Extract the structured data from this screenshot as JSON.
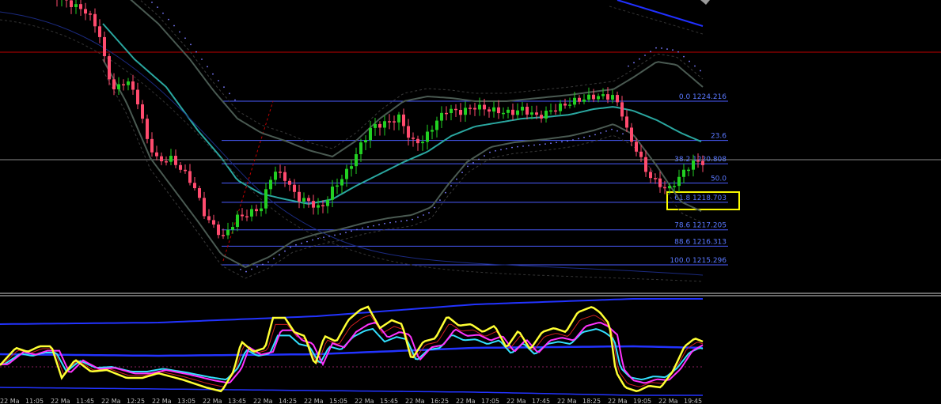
{
  "chart_data": {
    "type": "candlestick",
    "fib_levels": [
      {
        "label": "0.0 1224.216",
        "price": 1224.216
      },
      {
        "label": "23.6",
        "price": 1222.08
      },
      {
        "label": "38.2 1220.808",
        "price": 1220.808
      },
      {
        "label": "50.0",
        "price": 1219.756
      },
      {
        "label": "61.8 1218.703",
        "price": 1218.703
      },
      {
        "label": "78.6 1217.205",
        "price": 1217.205
      },
      {
        "label": "88.6 1216.313",
        "price": 1216.313
      },
      {
        "label": "100.0 1215.296",
        "price": 1215.296
      }
    ],
    "highlighted_level": "61.8 1218.703",
    "x_tick_labels": [
      "22 Ma",
      "11:05",
      "22 Ma",
      "11:45",
      "22 Ma",
      "12:25",
      "22 Ma",
      "13:05",
      "22 Ma",
      "13:45",
      "22 Ma",
      "14:25",
      "22 Ma",
      "15:05",
      "22 Ma",
      "15:45",
      "22 Ma",
      "16:25",
      "22 Ma",
      "17:05",
      "22 Ma",
      "17:45",
      "22 Ma",
      "18:25",
      "22 Ma",
      "19:05",
      "22 Ma",
      "19:45"
    ],
    "colors": {
      "bull": "#22d022",
      "bear": "#ff4b6e",
      "fib": "#4a5cff",
      "band": "#4a5a52",
      "ma": "#2aa7a0",
      "red_line": "#c00000",
      "grey_line": "#8a8a8a",
      "highlight": "#ffff00",
      "osc_yellow": "#ffff33",
      "osc_cyan": "#33e0ff",
      "osc_magenta": "#ff33ff",
      "osc_blue": "#2233ff"
    }
  }
}
